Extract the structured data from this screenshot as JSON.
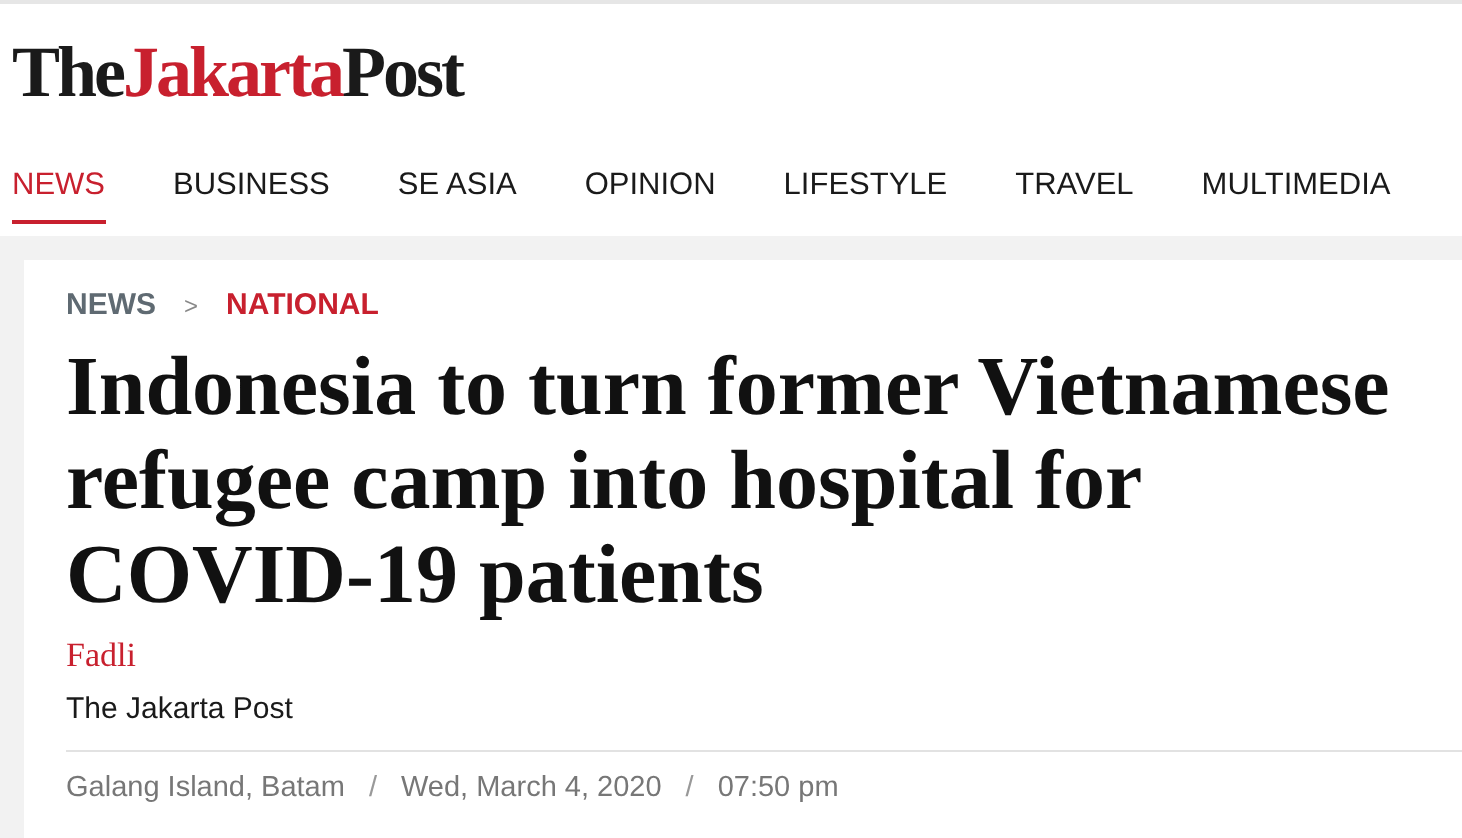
{
  "logo": [
    {
      "text": "The",
      "accent": false
    },
    {
      "text": "Jakarta",
      "accent": true
    },
    {
      "text": "Post",
      "accent": false
    }
  ],
  "nav": [
    {
      "label": "NEWS",
      "selected": true
    },
    {
      "label": "BUSINESS",
      "selected": false
    },
    {
      "label": "SE ASIA",
      "selected": false
    },
    {
      "label": "OPINION",
      "selected": false
    },
    {
      "label": "LIFESTYLE",
      "selected": false
    },
    {
      "label": "TRAVEL",
      "selected": false
    },
    {
      "label": "MULTIMEDIA",
      "selected": false
    }
  ],
  "breadcrumb": [
    {
      "kind": "link",
      "text": "NEWS",
      "current": false
    },
    {
      "kind": "sep",
      "text": ">"
    },
    {
      "kind": "link",
      "text": "NATIONAL",
      "current": true
    }
  ],
  "headline": "Indonesia to turn former Vietnamese refugee camp into hospital for COVID-19 patients",
  "author": "Fadli",
  "source": "The Jakarta Post",
  "meta": [
    {
      "kind": "text",
      "text": "Galang Island, Batam"
    },
    {
      "kind": "sep",
      "text": "/"
    },
    {
      "kind": "text",
      "text": "Wed, March 4, 2020"
    },
    {
      "kind": "sep",
      "text": "/"
    },
    {
      "kind": "text",
      "text": "07:50 pm"
    }
  ]
}
